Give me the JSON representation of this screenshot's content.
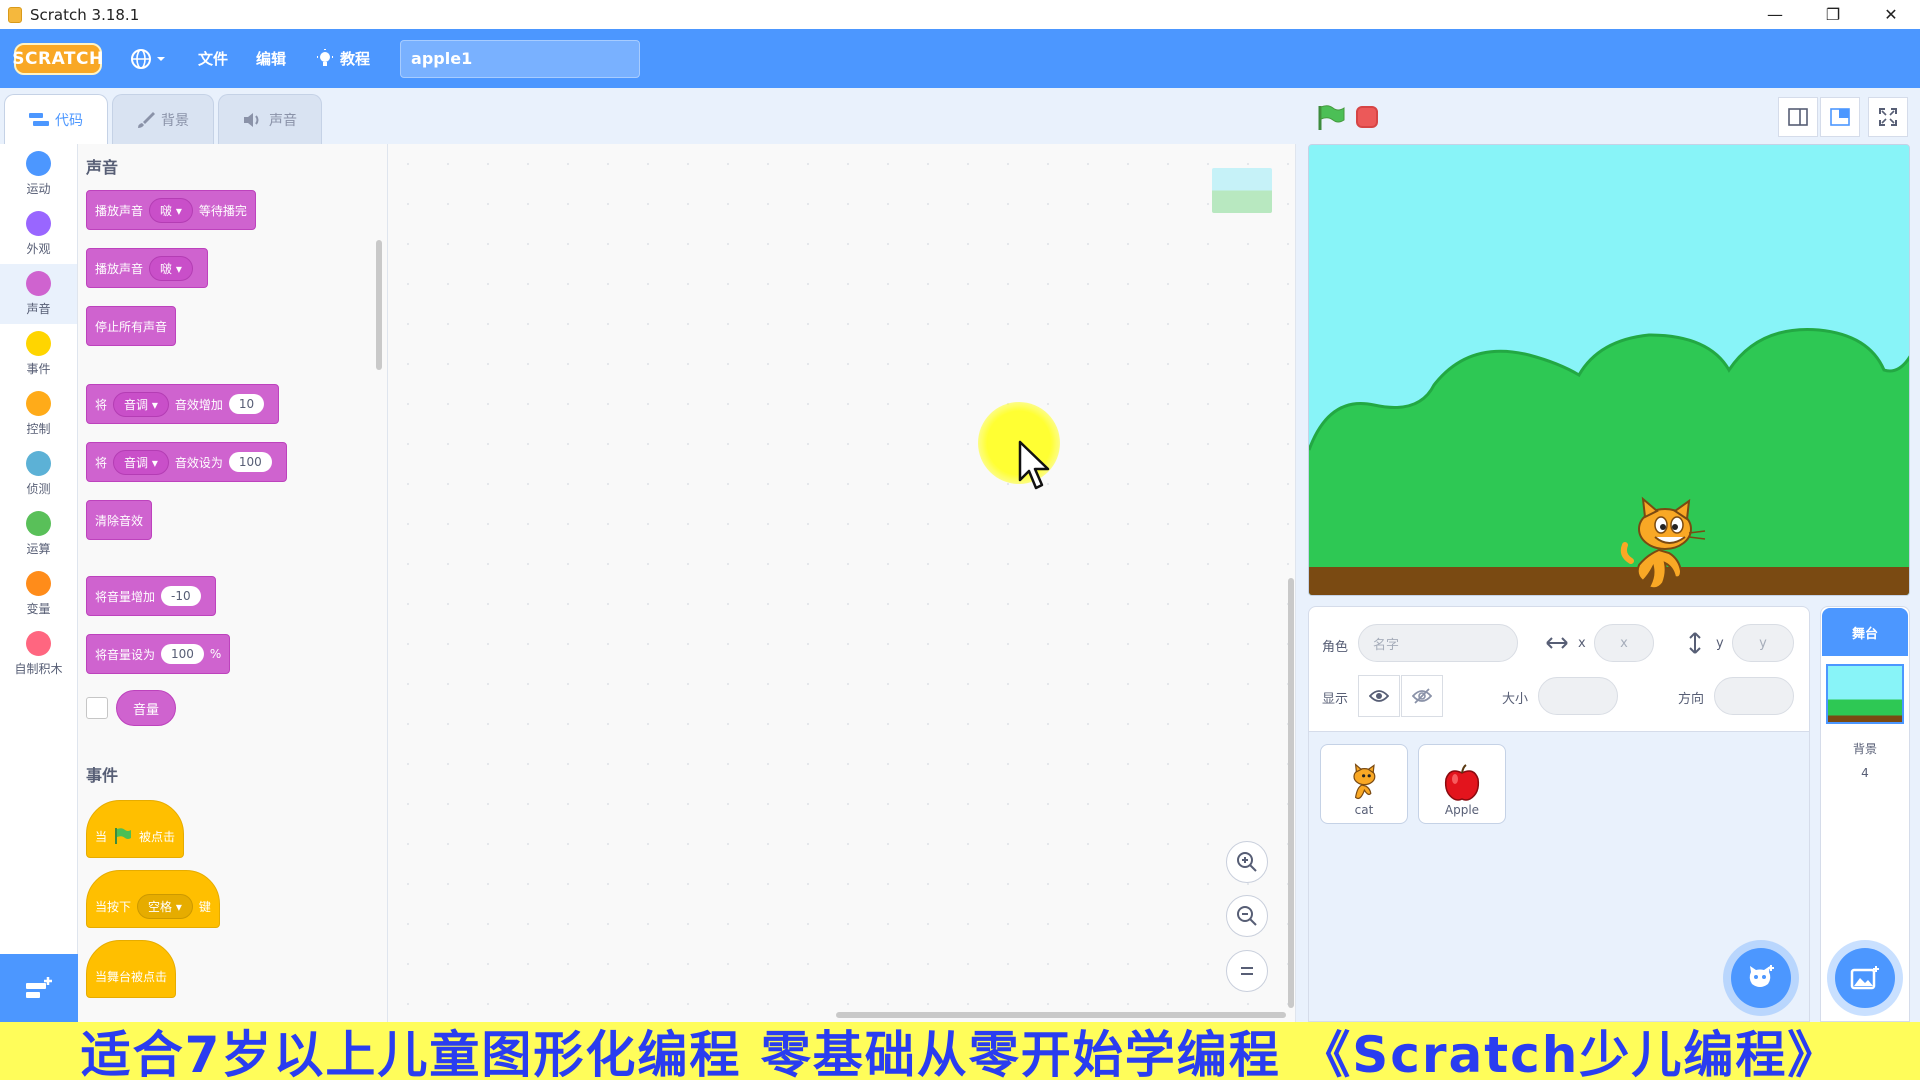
{
  "window": {
    "title": "Scratch 3.18.1",
    "minimize": "—",
    "restore": "❐",
    "close": "✕"
  },
  "menubar": {
    "logo": "SCRATCH",
    "file": "文件",
    "edit": "编辑",
    "tutorials": "教程",
    "project_title": "apple1"
  },
  "tabs": {
    "code": "代码",
    "backdrop": "背景",
    "sounds": "声音"
  },
  "categories": [
    {
      "label": "运动",
      "color": "#4c97ff"
    },
    {
      "label": "外观",
      "color": "#9966ff"
    },
    {
      "label": "声音",
      "color": "#cf63cf"
    },
    {
      "label": "事件",
      "color": "#ffd500"
    },
    {
      "label": "控制",
      "color": "#ffab19"
    },
    {
      "label": "侦测",
      "color": "#5cb1d6"
    },
    {
      "label": "运算",
      "color": "#59c059"
    },
    {
      "label": "变量",
      "color": "#ff8c1a"
    },
    {
      "label": "自制积木",
      "color": "#ff6680"
    }
  ],
  "palette": {
    "sound_heading": "声音",
    "play_until_done": {
      "a": "播放声音",
      "menu": "啵",
      "b": "等待播完"
    },
    "start_sound": {
      "a": "播放声音",
      "menu": "啵"
    },
    "stop_all": "停止所有声音",
    "change_effect": {
      "a": "将",
      "menu": "音调",
      "b": "音效增加",
      "value": "10"
    },
    "set_effect": {
      "a": "将",
      "menu": "音调",
      "b": "音效设为",
      "value": "100"
    },
    "clear_effects": "清除音效",
    "change_volume": {
      "a": "将音量增加",
      "value": "-10"
    },
    "set_volume": {
      "a": "将音量设为",
      "value": "100",
      "unit": "%"
    },
    "volume_reporter": "音量",
    "events_heading": "事件",
    "when_flag": {
      "a": "当",
      "b": "被点击"
    },
    "when_key": {
      "a": "当按下",
      "menu": "空格",
      "b": "键"
    },
    "when_stage_clicked": "当舞台被点击"
  },
  "sprite_info": {
    "sprite_label": "角色",
    "name_placeholder": "名字",
    "x_label": "x",
    "x_placeholder": "x",
    "y_label": "y",
    "y_placeholder": "y",
    "show_label": "显示",
    "size_label": "大小",
    "direction_label": "方向"
  },
  "sprites": [
    {
      "name": "cat"
    },
    {
      "name": "Apple"
    }
  ],
  "stage_pane": {
    "header": "舞台",
    "backdrops_label": "背景",
    "backdrops_count": "4"
  },
  "banner": "适合7岁以上儿童图形化编程  零基础从零开始学编程 《Scratch少儿编程》"
}
